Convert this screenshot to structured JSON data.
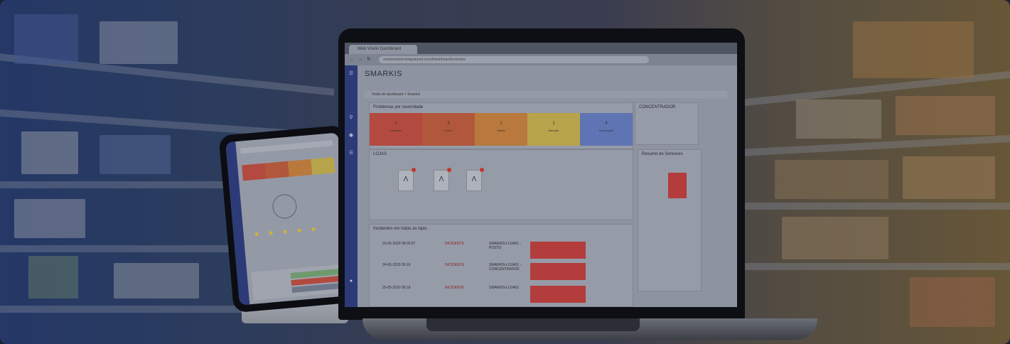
{
  "laptop": {
    "tab_title": "Web Vision Dashboard",
    "url": "smartmonitor.thingsboard.cloud/dashboard/overview",
    "app_title": "SMARKIS",
    "breadcrumb": "Visão de dashboard > Smarkis",
    "panel_severity_title": "Problemas por severidade",
    "severity": [
      {
        "count": "1",
        "label": "Desastre",
        "color": "#b34a3f"
      },
      {
        "count": "3",
        "label": "Grave",
        "color": "#b0573c"
      },
      {
        "count": "1",
        "label": "Média",
        "color": "#b9793c"
      },
      {
        "count": "1",
        "label": "Atenção",
        "color": "#b7a44a"
      },
      {
        "count": "4",
        "label": "Informação",
        "color": "#5f74b3"
      }
    ],
    "panel_stores_title": "LOJAS",
    "stores": [
      "Λ",
      "Λ",
      "Λ"
    ],
    "panel_concentrator_title": "CONCENTRADOR",
    "panel_summary_title": "Resumo de Sensores",
    "panel_incidents_title": "Incidentes em todas as lojas",
    "incident_rows": [
      {
        "date": "23-05-2020 08:00:57",
        "type": "INCIDENTE",
        "host": "SMARKIS-LOJA01 - POSTO"
      },
      {
        "date": "24-05-2020 09:16",
        "type": "INCIDENTE",
        "host": "SMARKIS-LOJA01 - CONCENTRADOR"
      },
      {
        "date": "25-05-2020 08:18",
        "type": "INCIDENTE",
        "host": "SMARKIS-LOJA01"
      }
    ]
  }
}
